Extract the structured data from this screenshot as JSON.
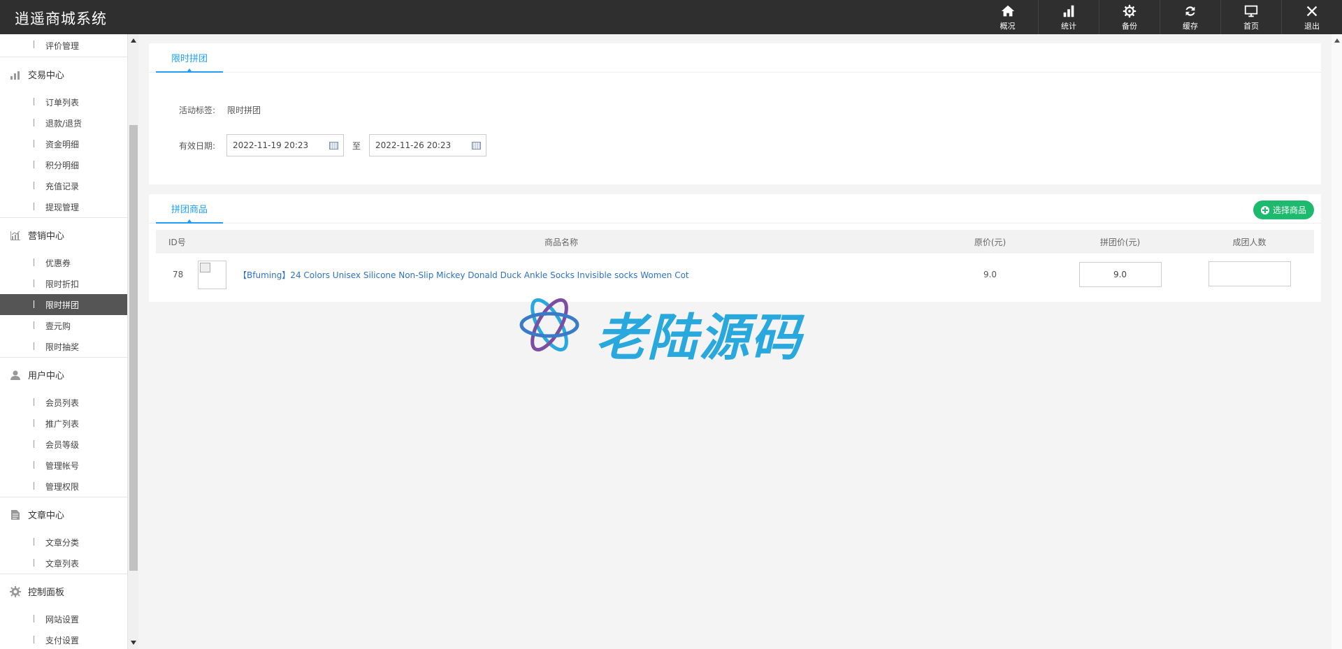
{
  "header": {
    "brand": "逍遥商城系统",
    "nav": [
      {
        "label": "概况",
        "icon": "home-icon"
      },
      {
        "label": "统计",
        "icon": "bar-chart-icon"
      },
      {
        "label": "备份",
        "icon": "gear-icon"
      },
      {
        "label": "缓存",
        "icon": "refresh-icon"
      },
      {
        "label": "首页",
        "icon": "monitor-icon"
      },
      {
        "label": "退出",
        "icon": "close-icon"
      }
    ]
  },
  "sidebar": {
    "top_item": "评价管理",
    "groups": [
      {
        "title": "交易中心",
        "icon": "bar-chart-icon",
        "items": [
          "订单列表",
          "退款/退货",
          "资金明细",
          "积分明细",
          "充值记录",
          "提现管理"
        ]
      },
      {
        "title": "营销中心",
        "icon": "trend-chart-icon",
        "items": [
          "优惠券",
          "限时折扣",
          "限时拼团",
          "壹元购",
          "限时抽奖"
        ]
      },
      {
        "title": "用户中心",
        "icon": "user-icon",
        "items": [
          "会员列表",
          "推广列表",
          "会员等级",
          "管理帐号",
          "管理权限"
        ]
      },
      {
        "title": "文章中心",
        "icon": "document-icon",
        "items": [
          "文章分类",
          "文章列表"
        ]
      },
      {
        "title": "控制面板",
        "icon": "settings-icon",
        "items": [
          "网站设置",
          "支付设置"
        ]
      }
    ],
    "active_item": "限时拼团"
  },
  "activity": {
    "tab": "限时拼团",
    "tag_label": "活动标签:",
    "tag_value": "限时拼团",
    "date_label": "有效日期:",
    "start_date": "2022-11-19 20:23",
    "separator": "至",
    "end_date": "2022-11-26 20:23"
  },
  "goods": {
    "tab": "拼团商品",
    "add_button": "选择商品",
    "columns": [
      "ID号",
      "商品名称",
      "原价(元)",
      "拼团价(元)",
      "成团人数"
    ],
    "rows": [
      {
        "id": "78",
        "name": "【Bfuming】24 Colors Unisex Silicone Non-Slip Mickey Donald Duck Ankle Socks Invisible socks Women Cot",
        "original_price": "9.0",
        "group_price": "9.0",
        "group_size": ""
      }
    ]
  },
  "watermark": {
    "text": "老陆源码"
  }
}
